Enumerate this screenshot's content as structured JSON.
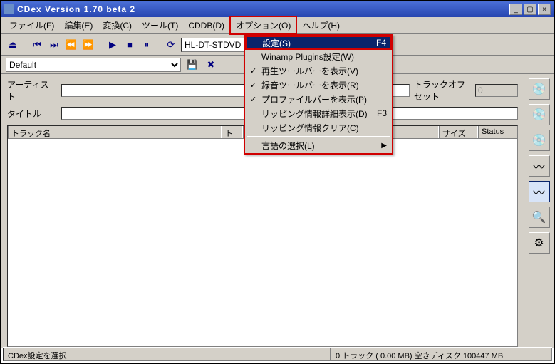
{
  "titlebar": {
    "title": "CDex Version 1.70 beta 2"
  },
  "menu": {
    "file": "ファイル(F)",
    "edit": "編集(E)",
    "convert": "変換(C)",
    "tools": "ツール(T)",
    "cddb": "CDDB(D)",
    "options": "オプション(O)",
    "help": "ヘルプ(H)"
  },
  "toolbar": {
    "drive_value": "HL-DT-STDVD"
  },
  "profile": {
    "selected": "Default"
  },
  "fields": {
    "artist_label": "アーティスト",
    "artist_value": "",
    "title_label": "タイトル",
    "title_value": "",
    "trackoffset_label": "トラックオフセット",
    "trackoffset_value": "0"
  },
  "list_cols": {
    "name": "トラック名",
    "track": "ト",
    "size": "サイズ",
    "status": "Status"
  },
  "dropdown": {
    "settings": {
      "label": "設定(S)",
      "shortcut": "F4"
    },
    "winamp": "Winamp Plugins設定(W)",
    "playbar": "再生ツールバーを表示(V)",
    "recbar": "録音ツールバーを表示(R)",
    "profilebar": "プロファイルバーを表示(P)",
    "ripdetail": {
      "label": "リッピング情報詳細表示(D)",
      "shortcut": "F3"
    },
    "ripclear": "リッピング情報クリア(C)",
    "language": "言語の選択(L)"
  },
  "statusbar": {
    "left": "CDex設定を選択",
    "right": "0 トラック ( 0.00 MB) 空きディスク 100447 MB"
  }
}
